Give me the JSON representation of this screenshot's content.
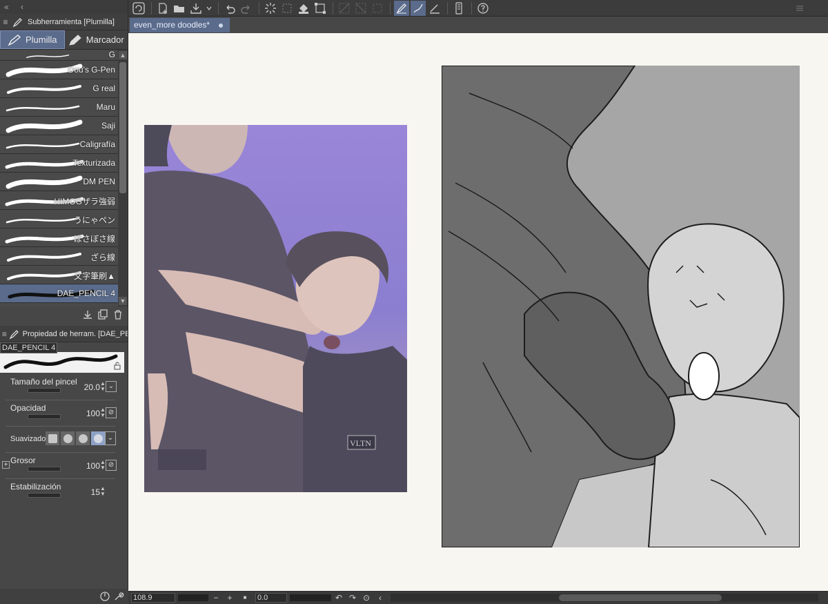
{
  "left_top": {
    "collapse": "«",
    "back": "‹"
  },
  "subtool_panel": {
    "title": "Subherramienta [Plumilla]"
  },
  "tool_tabs": [
    {
      "label": "Plumilla",
      "active": true
    },
    {
      "label": "Marcador",
      "active": false
    }
  ],
  "brushes": [
    {
      "name": "G",
      "shape": "thin"
    },
    {
      "name": "Dou's G-Pen",
      "shape": "thick"
    },
    {
      "name": "G real",
      "shape": "medium"
    },
    {
      "name": "Maru",
      "shape": "thin"
    },
    {
      "name": "Saji",
      "shape": "thick"
    },
    {
      "name": "Caligrafía",
      "shape": "thin"
    },
    {
      "name": "Texturizada",
      "shape": "rough"
    },
    {
      "name": "DM PEN",
      "shape": "thick"
    },
    {
      "name": "HIMOGザラ強弱",
      "shape": "rough"
    },
    {
      "name": "うにゃペン",
      "shape": "thin"
    },
    {
      "name": "ぼさぼさ線",
      "shape": "rough"
    },
    {
      "name": "ざら線",
      "shape": "medium"
    },
    {
      "name": "文字筆刷▲",
      "shape": "medium"
    },
    {
      "name": "DAE_PENCIL 4",
      "shape": "dark",
      "selected": true
    }
  ],
  "property_panel": {
    "title": "Propiedad de herram. [DAE_PENCIL 4]",
    "brush_name": "DAE_PENCIL 4"
  },
  "properties": {
    "size": {
      "label": "Tamaño del pincel",
      "value": "20.0"
    },
    "opacity": {
      "label": "Opacidad",
      "value": "100"
    },
    "smoothing": {
      "label": "Suavizado"
    },
    "thickness": {
      "label": "Grosor",
      "value": "100"
    },
    "stabilization": {
      "label": "Estabilización",
      "value": "15"
    }
  },
  "document": {
    "tab_title": "even_more doodles*"
  },
  "status": {
    "zoom": "108.9",
    "angle": "0.0"
  },
  "colors": {
    "accent": "#5a6b8c",
    "panel_bg": "#474747",
    "canvas_bg": "#f8f6f1"
  }
}
